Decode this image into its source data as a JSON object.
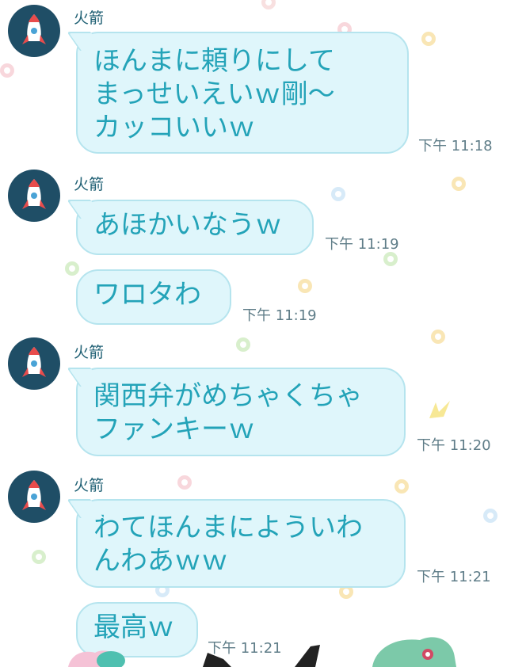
{
  "theme": {
    "bubble": "#dff6fb",
    "bubble_border": "#b5e4ee",
    "text": "#23a3b8",
    "avatar_bg": "#1f4e66"
  },
  "messages": [
    {
      "sender": "火箭",
      "lines": [
        "ほんまに頼りにして",
        "まっせいえいｗ剛～",
        "カッコいいｗ"
      ],
      "time": "下午 11:18",
      "avatar_icon": "rocket-icon"
    },
    {
      "sender": "火箭",
      "lines": [
        "あほかいなうｗ"
      ],
      "time": "下午 11:19",
      "avatar_icon": "rocket-icon"
    },
    {
      "lines": [
        "ワロタわ"
      ],
      "time": "下午 11:19"
    },
    {
      "sender": "火箭",
      "lines": [
        "関西弁がめちゃくちゃ",
        "ファンキーｗ"
      ],
      "time": "下午 11:20",
      "avatar_icon": "rocket-icon"
    },
    {
      "sender": "火箭",
      "lines": [
        "わてほんまにようい​わ",
        "んわあｗｗ"
      ],
      "time": "下午 11:21",
      "avatar_icon": "rocket-icon"
    },
    {
      "lines": [
        "最高ｗ"
      ],
      "time": "下午 11:21"
    }
  ],
  "background_icons": [
    "pokeball-icon",
    "pikachu-icon",
    "bulbasaur-sticker-icon"
  ]
}
